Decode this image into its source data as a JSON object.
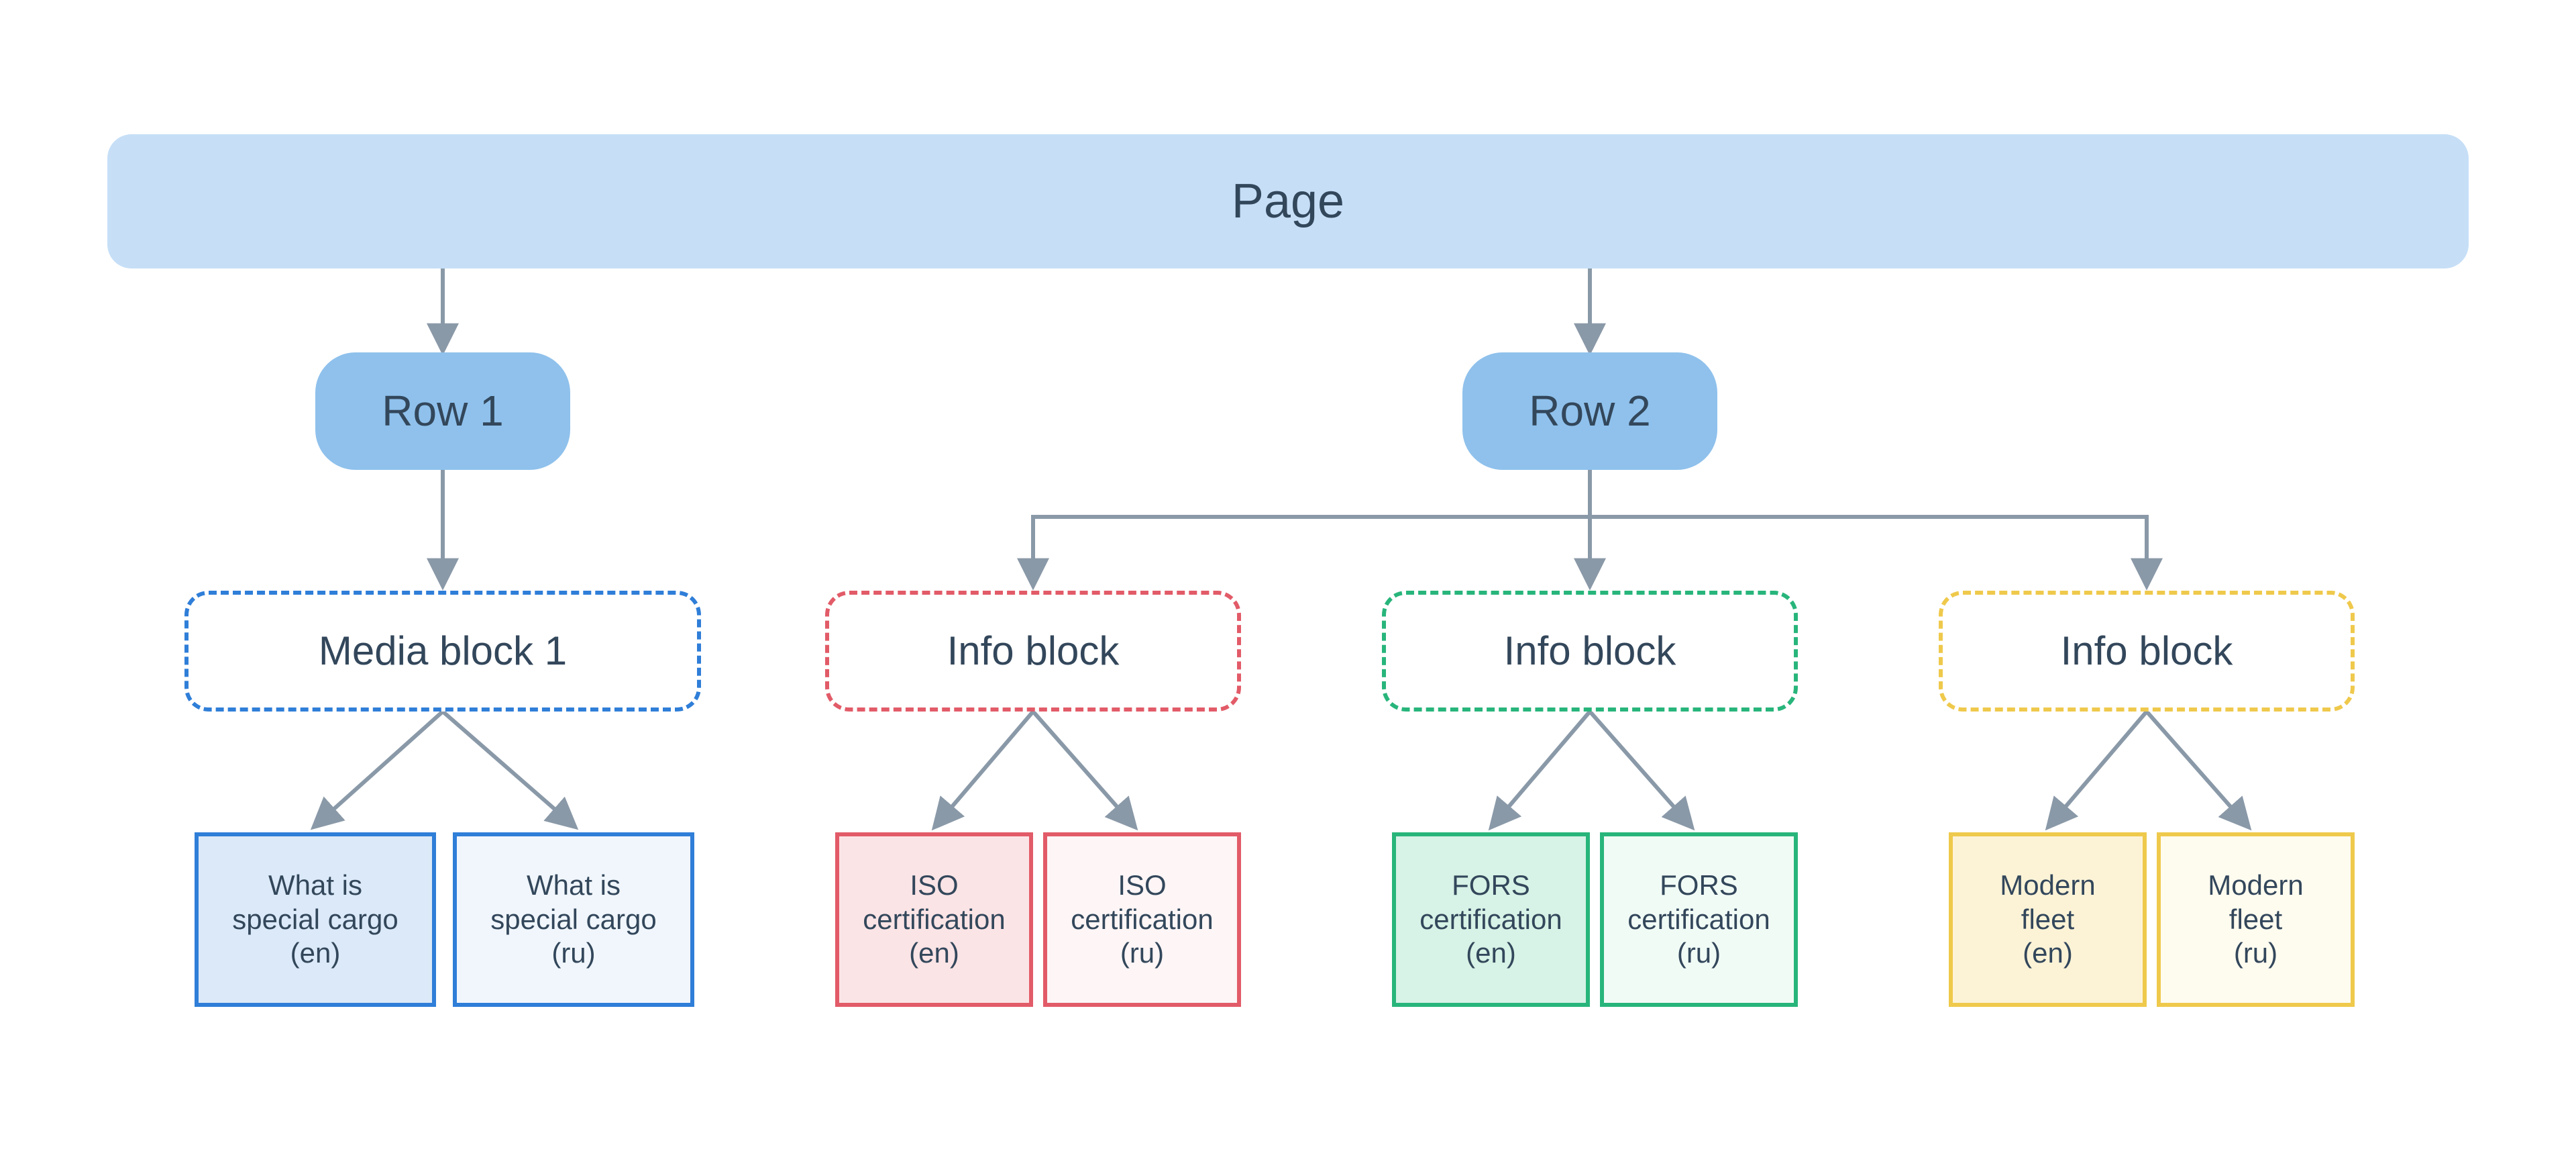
{
  "colors": {
    "text": "#33475b",
    "page_bg": "#c6dff7",
    "row_bg": "#8fc1ec",
    "blue": "#2f7ed8",
    "red": "#e25b68",
    "green": "#28b57b",
    "yellow": "#efc94c",
    "arrow": "#8a99a8"
  },
  "root": {
    "label": "Page"
  },
  "rows": [
    {
      "id": "row1",
      "label": "Row 1"
    },
    {
      "id": "row2",
      "label": "Row 2"
    }
  ],
  "blocks": [
    {
      "id": "media1",
      "label": "Media block 1",
      "color": "blue",
      "parent": "row1"
    },
    {
      "id": "info1",
      "label": "Info block",
      "color": "red",
      "parent": "row2"
    },
    {
      "id": "info2",
      "label": "Info block",
      "color": "green",
      "parent": "row2"
    },
    {
      "id": "info3",
      "label": "Info block",
      "color": "yellow",
      "parent": "row2"
    }
  ],
  "leaves": [
    {
      "id": "sc_en",
      "label": "What is\nspecial cargo\n(en)",
      "parent": "media1",
      "shade": "dark"
    },
    {
      "id": "sc_ru",
      "label": "What is\nspecial cargo\n(ru)",
      "parent": "media1",
      "shade": "light"
    },
    {
      "id": "iso_en",
      "label": "ISO\ncertification\n(en)",
      "parent": "info1",
      "shade": "dark"
    },
    {
      "id": "iso_ru",
      "label": "ISO\ncertification\n(ru)",
      "parent": "info1",
      "shade": "light"
    },
    {
      "id": "fors_en",
      "label": "FORS\ncertification\n(en)",
      "parent": "info2",
      "shade": "dark"
    },
    {
      "id": "fors_ru",
      "label": "FORS\ncertification\n(ru)",
      "parent": "info2",
      "shade": "light"
    },
    {
      "id": "fleet_en",
      "label": "Modern\nfleet\n(en)",
      "parent": "info3",
      "shade": "dark"
    },
    {
      "id": "fleet_ru",
      "label": "Modern\nfleet\n(ru)",
      "parent": "info3",
      "shade": "light"
    }
  ]
}
